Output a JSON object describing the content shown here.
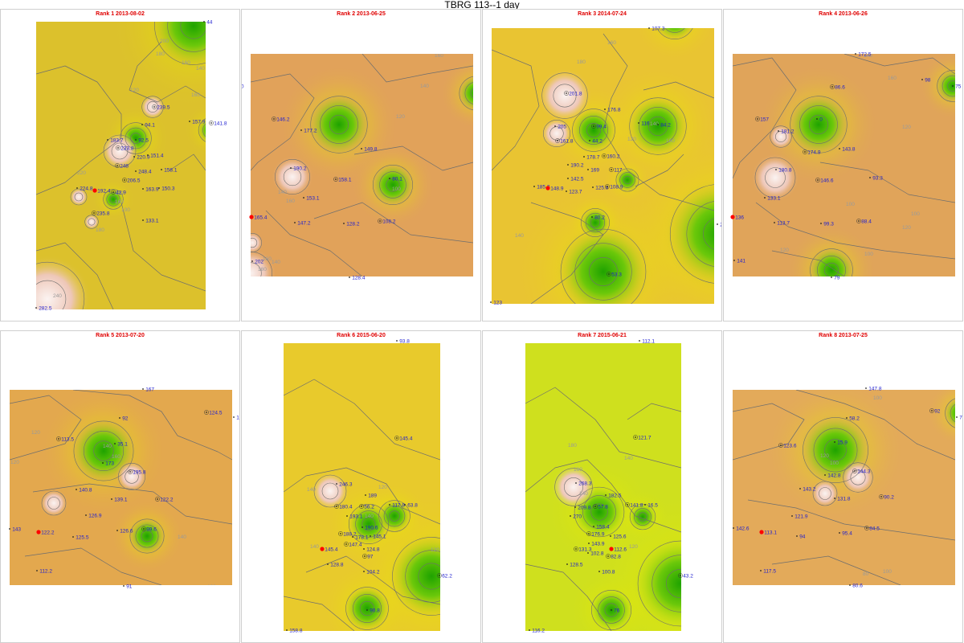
{
  "title": "TBRG 113--1 day",
  "colors": {
    "low": "#33b000",
    "mid": "#e6e600",
    "high": "#f3ddd6",
    "contour": "#6e6e6e",
    "station_text": "#1f1fd0",
    "target": "#ff0000",
    "panel_title": "#e00000"
  },
  "chart_data": [
    {
      "type": "heatmap",
      "title": "Rank 1 2013-08-02",
      "contour_levels": [
        "200",
        "180",
        "160",
        "140",
        "220",
        "240",
        "180",
        "100",
        "120",
        "140",
        "160",
        "160"
      ],
      "stations": [
        {
          "label": "44",
          "value": 44
        },
        {
          "label": "239.5",
          "value": 239.5
        },
        {
          "label": "94.1",
          "value": 94.1
        },
        {
          "label": "157.9",
          "value": 157.9
        },
        {
          "label": "141.8",
          "value": 141.8
        },
        {
          "label": "183.7",
          "value": 183.7
        },
        {
          "label": "92.5",
          "value": 92.5
        },
        {
          "label": "233.8",
          "value": 233.8
        },
        {
          "label": "220.9",
          "value": 220.9
        },
        {
          "label": "151.4",
          "value": 151.4
        },
        {
          "label": "248",
          "value": 248
        },
        {
          "label": "248.4",
          "value": 248.4
        },
        {
          "label": "158.1",
          "value": 158.1
        },
        {
          "label": "206.5",
          "value": 206.5
        },
        {
          "label": "224.8",
          "value": 224.8
        },
        {
          "label": "192.4",
          "value": 192.4
        },
        {
          "label": "42.9",
          "value": 42.9
        },
        {
          "label": "163.9",
          "value": 163.9
        },
        {
          "label": "150.3",
          "value": 150.3
        },
        {
          "label": "235.8",
          "value": 235.8
        },
        {
          "label": "133.1",
          "value": 133.1
        },
        {
          "label": "282.5",
          "value": 282.5
        }
      ]
    },
    {
      "type": "heatmap",
      "title": "Rank 2 2013-06-25",
      "contour_levels": [
        "180",
        "160",
        "140",
        "120",
        "100",
        "140",
        "160",
        "140",
        "160",
        "180"
      ],
      "stations": [
        {
          "label": "181.2",
          "value": 181.2
        },
        {
          "label": "102.4",
          "value": 102.4
        },
        {
          "label": "60",
          "value": 60
        },
        {
          "label": "99.8",
          "value": 99.8
        },
        {
          "label": "146.2",
          "value": 146.2
        },
        {
          "label": "0",
          "value": 0
        },
        {
          "label": "177.2",
          "value": 177.2
        },
        {
          "label": "173",
          "value": 173
        },
        {
          "label": "149.8",
          "value": 149.8
        },
        {
          "label": "190.2",
          "value": 190.2
        },
        {
          "label": "158.1",
          "value": 158.1
        },
        {
          "label": "80.1",
          "value": 80.1
        },
        {
          "label": "153.1",
          "value": 153.1
        },
        {
          "label": "165.4",
          "value": 165.4
        },
        {
          "label": "147.2",
          "value": 147.2
        },
        {
          "label": "128.2",
          "value": 128.2
        },
        {
          "label": "108.2",
          "value": 108.2
        },
        {
          "label": "202",
          "value": 202
        },
        {
          "label": "128.4",
          "value": 128.4
        }
      ]
    },
    {
      "type": "heatmap",
      "title": "Rank 3 2014-07-24",
      "contour_levels": [
        "160",
        "180",
        "140",
        "140",
        "120",
        "160"
      ],
      "stations": [
        {
          "label": "107.3",
          "value": 107.3
        },
        {
          "label": "201.8",
          "value": 201.8
        },
        {
          "label": "176.8",
          "value": 176.8
        },
        {
          "label": "205",
          "value": 205
        },
        {
          "label": "99.4",
          "value": 99.4
        },
        {
          "label": "116",
          "value": 116
        },
        {
          "label": "84.2",
          "value": 84.2
        },
        {
          "label": "161.8",
          "value": 161.8
        },
        {
          "label": "44.2",
          "value": 44.2
        },
        {
          "label": "178.7",
          "value": 178.7
        },
        {
          "label": "160.2",
          "value": 160.2
        },
        {
          "label": "190.2",
          "value": 190.2
        },
        {
          "label": "169",
          "value": 169
        },
        {
          "label": "117",
          "value": 117
        },
        {
          "label": "142.5",
          "value": 142.5
        },
        {
          "label": "185.3",
          "value": 185.3
        },
        {
          "label": "148.9",
          "value": 148.9
        },
        {
          "label": "123.7",
          "value": 123.7
        },
        {
          "label": "125.8",
          "value": 125.8
        },
        {
          "label": "108.9",
          "value": 108.9
        },
        {
          "label": "80.2",
          "value": 80.2
        },
        {
          "label": "23",
          "value": 23
        },
        {
          "label": "53.3",
          "value": 53.3
        },
        {
          "label": "123",
          "value": 123
        }
      ]
    },
    {
      "type": "heatmap",
      "title": "Rank 4 2013-06-26",
      "contour_levels": [
        "140",
        "160",
        "120",
        "100",
        "100",
        "120",
        "120",
        "100"
      ],
      "stations": [
        {
          "label": "172.5",
          "value": 172.5
        },
        {
          "label": "86.6",
          "value": 86.6
        },
        {
          "label": "98",
          "value": 98
        },
        {
          "label": "75",
          "value": 75
        },
        {
          "label": "157",
          "value": 157
        },
        {
          "label": "0",
          "value": 0
        },
        {
          "label": "181.2",
          "value": 181.2
        },
        {
          "label": "174.9",
          "value": 174.9
        },
        {
          "label": "143.8",
          "value": 143.8
        },
        {
          "label": "180.8",
          "value": 180.8
        },
        {
          "label": "146.6",
          "value": 146.6
        },
        {
          "label": "93.3",
          "value": 93.3
        },
        {
          "label": "133.1",
          "value": 133.1
        },
        {
          "label": "136",
          "value": 136
        },
        {
          "label": "113.7",
          "value": 113.7
        },
        {
          "label": "99.3",
          "value": 99.3
        },
        {
          "label": "88.4",
          "value": 88.4
        },
        {
          "label": "141",
          "value": 141
        },
        {
          "label": "79",
          "value": 79
        }
      ]
    },
    {
      "type": "heatmap",
      "title": "Rank 5 2013-07-20",
      "contour_levels": [
        "120",
        "140",
        "160",
        "140",
        "120",
        "100"
      ],
      "stations": [
        {
          "label": "167",
          "value": 167
        },
        {
          "label": "124.5",
          "value": 124.5
        },
        {
          "label": "1",
          "value": 1
        },
        {
          "label": "92",
          "value": 92
        },
        {
          "label": "113.5",
          "value": 113.5
        },
        {
          "label": "35.1",
          "value": 35.1
        },
        {
          "label": "173",
          "value": 173
        },
        {
          "label": "195.8",
          "value": 195.8
        },
        {
          "label": "140.8",
          "value": 140.8
        },
        {
          "label": "139.1",
          "value": 139.1
        },
        {
          "label": "122.2",
          "value": 122.2
        },
        {
          "label": "126.9",
          "value": 126.9
        },
        {
          "label": "143",
          "value": 143
        },
        {
          "label": "122.2",
          "value": 122.2
        },
        {
          "label": "125.5",
          "value": 125.5
        },
        {
          "label": "126.6",
          "value": 126.6
        },
        {
          "label": "99.6",
          "value": 99.6
        },
        {
          "label": "112.2",
          "value": 112.2
        },
        {
          "label": "91",
          "value": 91
        }
      ]
    },
    {
      "type": "heatmap",
      "title": "Rank 6 2015-06-20",
      "contour_levels": [
        "140",
        "140",
        "140",
        "120",
        "120"
      ],
      "stations": [
        {
          "label": "93.8",
          "value": 93.8
        },
        {
          "label": "145.4",
          "value": 145.4
        },
        {
          "label": "246.3",
          "value": 246.3
        },
        {
          "label": "189",
          "value": 189
        },
        {
          "label": "56.2",
          "value": 56.2
        },
        {
          "label": "117.8",
          "value": 117.8
        },
        {
          "label": "63.8",
          "value": 63.8
        },
        {
          "label": "180.4",
          "value": 180.4
        },
        {
          "label": "193.1",
          "value": 193.1
        },
        {
          "label": "190.6",
          "value": 190.6
        },
        {
          "label": "188.2",
          "value": 188.2
        },
        {
          "label": "178.1",
          "value": 178.1
        },
        {
          "label": "145.1",
          "value": 145.1
        },
        {
          "label": "147.4",
          "value": 147.4
        },
        {
          "label": "145.4",
          "value": 145.4
        },
        {
          "label": "124.8",
          "value": 124.8
        },
        {
          "label": "97",
          "value": 97
        },
        {
          "label": "128.8",
          "value": 128.8
        },
        {
          "label": "104.2",
          "value": 104.2
        },
        {
          "label": "62.2",
          "value": 62.2
        },
        {
          "label": "90.8",
          "value": 90.8
        },
        {
          "label": "158.8",
          "value": 158.8
        }
      ]
    },
    {
      "type": "heatmap",
      "title": "Rank 7 2015-06-21",
      "contour_levels": [
        "140",
        "180",
        "160",
        "140",
        "120"
      ],
      "stations": [
        {
          "label": "112.1",
          "value": 112.1
        },
        {
          "label": "121.7",
          "value": 121.7
        },
        {
          "label": "268.3",
          "value": 268.3
        },
        {
          "label": "182.5",
          "value": 182.5
        },
        {
          "label": "141.8",
          "value": 141.8
        },
        {
          "label": "16.5",
          "value": 16.5
        },
        {
          "label": "209.8",
          "value": 209.8
        },
        {
          "label": "57.8",
          "value": 57.8
        },
        {
          "label": "270",
          "value": 270
        },
        {
          "label": "158.4",
          "value": 158.4
        },
        {
          "label": "176.9",
          "value": 176.9
        },
        {
          "label": "125.6",
          "value": 125.6
        },
        {
          "label": "143.9",
          "value": 143.9
        },
        {
          "label": "131.3",
          "value": 131.3
        },
        {
          "label": "112.6",
          "value": 112.6
        },
        {
          "label": "102.8",
          "value": 102.8
        },
        {
          "label": "82.8",
          "value": 82.8
        },
        {
          "label": "128.5",
          "value": 128.5
        },
        {
          "label": "100.8",
          "value": 100.8
        },
        {
          "label": "43.2",
          "value": 43.2
        },
        {
          "label": "76",
          "value": 76
        },
        {
          "label": "116.2",
          "value": 116.2
        }
      ]
    },
    {
      "type": "heatmap",
      "title": "Rank 8 2013-07-25",
      "contour_levels": [
        "100",
        "120",
        "100",
        "100",
        "80"
      ],
      "stations": [
        {
          "label": "147.8",
          "value": 147.8
        },
        {
          "label": "92",
          "value": 92
        },
        {
          "label": "75",
          "value": 75
        },
        {
          "label": "58.2",
          "value": 58.2
        },
        {
          "label": "123.6",
          "value": 123.6
        },
        {
          "label": "15.9",
          "value": 15.9
        },
        {
          "label": "142.8",
          "value": 142.8
        },
        {
          "label": "144.3",
          "value": 144.3
        },
        {
          "label": "143.2",
          "value": 143.2
        },
        {
          "label": "131.8",
          "value": 131.8
        },
        {
          "label": "90.2",
          "value": 90.2
        },
        {
          "label": "121.9",
          "value": 121.9
        },
        {
          "label": "142.6",
          "value": 142.6
        },
        {
          "label": "113.1",
          "value": 113.1
        },
        {
          "label": "94",
          "value": 94
        },
        {
          "label": "95.4",
          "value": 95.4
        },
        {
          "label": "84.5",
          "value": 84.5
        },
        {
          "label": "117.5",
          "value": 117.5
        },
        {
          "label": "80.6",
          "value": 80.6
        }
      ]
    }
  ]
}
